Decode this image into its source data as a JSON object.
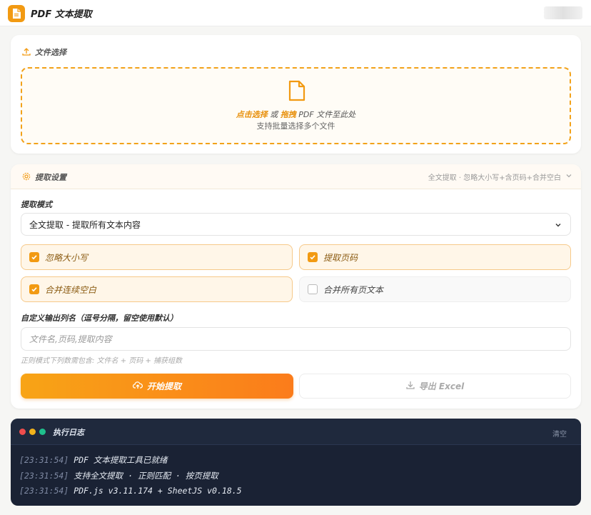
{
  "app": {
    "title": "PDF 文本提取"
  },
  "file_section": {
    "title": "文件选择",
    "drop_click": "点击选择",
    "drop_or": "或",
    "drop_drag": "拖拽",
    "drop_rest": "PDF 文件至此处",
    "drop_hint": "支持批量选择多个文件"
  },
  "settings": {
    "title": "提取设置",
    "summary": "全文提取 · 忽略大小写+含页码+合并空白",
    "mode_label": "提取模式",
    "mode_value": "全文提取 - 提取所有文本内容",
    "options": [
      {
        "label": "忽略大小写",
        "checked": true
      },
      {
        "label": "提取页码",
        "checked": true
      },
      {
        "label": "合并连续空白",
        "checked": true
      },
      {
        "label": "合并所有页文本",
        "checked": false
      }
    ],
    "columns_label": "自定义输出列名（逗号分隔，留空使用默认）",
    "columns_placeholder": "文件名,页码,提取内容",
    "columns_hint": "正则模式下列数需包含: 文件名 + 页码 + 捕获组数",
    "start_button": "开始提取",
    "export_button": "导出 Excel"
  },
  "log": {
    "title": "执行日志",
    "clear": "清空",
    "lines": [
      {
        "time": "[23:31:54]",
        "text": "PDF 文本提取工具已就绪"
      },
      {
        "time": "[23:31:54]",
        "text": "支持全文提取 · 正则匹配 · 按页提取"
      },
      {
        "time": "[23:31:54]",
        "text": "PDF.js v3.11.174 + SheetJS v0.18.5"
      }
    ]
  },
  "colors": {
    "accent": "#f29a12",
    "log_bg": "#1a2234",
    "dot_red": "#ef4d4d",
    "dot_yellow": "#f2b21b",
    "dot_green": "#1fbf8c"
  }
}
